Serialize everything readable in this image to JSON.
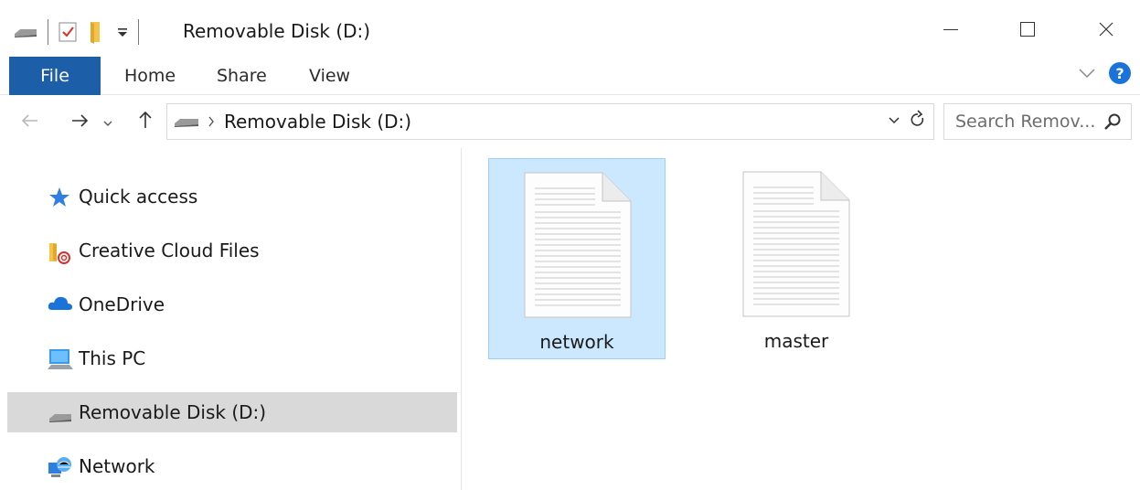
{
  "window": {
    "title": "Removable Disk (D:)",
    "controls": {
      "minimize_icon": "minimize-icon",
      "maximize_icon": "maximize-icon",
      "close_icon": "close-icon"
    }
  },
  "ribbon": {
    "tabs": [
      {
        "label": "File",
        "active": true
      },
      {
        "label": "Home"
      },
      {
        "label": "Share"
      },
      {
        "label": "View"
      }
    ],
    "help_glyph": "?"
  },
  "address_bar": {
    "breadcrumb": [
      "Removable Disk (D:)"
    ],
    "search_placeholder": "Search Remov..."
  },
  "nav_pane": {
    "items": [
      {
        "label": "Quick access",
        "icon": "star-icon"
      },
      {
        "label": "Creative Cloud Files",
        "icon": "creative-cloud-folder-icon"
      },
      {
        "label": "OneDrive",
        "icon": "onedrive-cloud-icon"
      },
      {
        "label": "This PC",
        "icon": "computer-icon"
      },
      {
        "label": "Removable Disk (D:)",
        "icon": "drive-icon",
        "selected": true
      },
      {
        "label": "Network",
        "icon": "network-icon"
      }
    ]
  },
  "files": [
    {
      "name": "network",
      "selected": true
    },
    {
      "name": "master",
      "selected": false
    }
  ],
  "colors": {
    "file_tab": "#1c5ea8",
    "selection_fill": "#cce8ff",
    "selection_border": "#99d1ff",
    "nav_selected": "#d9d9d9",
    "help_blue": "#1a73d9"
  }
}
